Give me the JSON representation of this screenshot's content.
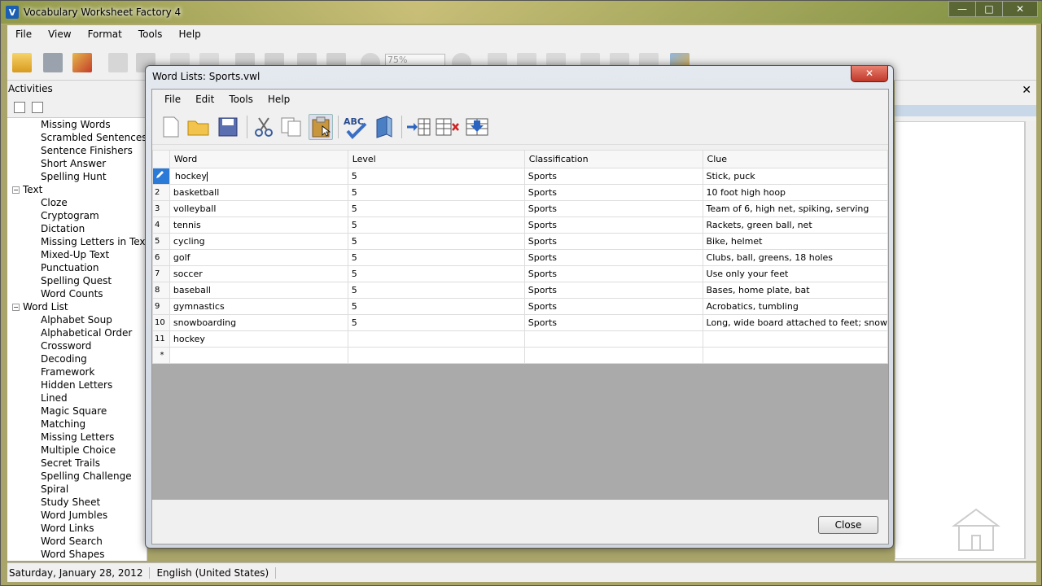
{
  "app": {
    "title": "Vocabulary Worksheet Factory 4",
    "icon_letter": "V"
  },
  "window_buttons": {
    "minimize": "—",
    "maximize": "□",
    "close": "✕"
  },
  "menu": [
    "File",
    "View",
    "Format",
    "Tools",
    "Help"
  ],
  "toolbar": {
    "zoom_value": "75%"
  },
  "activities": {
    "header": "Activities",
    "items": [
      {
        "label": "Missing Words",
        "level": 1
      },
      {
        "label": "Scrambled Sentences",
        "level": 1
      },
      {
        "label": "Sentence Finishers",
        "level": 1
      },
      {
        "label": "Short Answer",
        "level": 1
      },
      {
        "label": "Spelling Hunt",
        "level": 1
      },
      {
        "label": "Text",
        "level": 0
      },
      {
        "label": "Cloze",
        "level": 1
      },
      {
        "label": "Cryptogram",
        "level": 1
      },
      {
        "label": "Dictation",
        "level": 1
      },
      {
        "label": "Missing Letters in Text",
        "level": 1
      },
      {
        "label": "Mixed-Up Text",
        "level": 1
      },
      {
        "label": "Punctuation",
        "level": 1
      },
      {
        "label": "Spelling Quest",
        "level": 1
      },
      {
        "label": "Word Counts",
        "level": 1
      },
      {
        "label": "Word List",
        "level": 0
      },
      {
        "label": "Alphabet Soup",
        "level": 1
      },
      {
        "label": "Alphabetical Order",
        "level": 1
      },
      {
        "label": "Crossword",
        "level": 1
      },
      {
        "label": "Decoding",
        "level": 1
      },
      {
        "label": "Framework",
        "level": 1
      },
      {
        "label": "Hidden Letters",
        "level": 1
      },
      {
        "label": "Lined",
        "level": 1
      },
      {
        "label": "Magic Square",
        "level": 1
      },
      {
        "label": "Matching",
        "level": 1
      },
      {
        "label": "Missing Letters",
        "level": 1
      },
      {
        "label": "Multiple Choice",
        "level": 1
      },
      {
        "label": "Secret Trails",
        "level": 1
      },
      {
        "label": "Spelling Challenge",
        "level": 1
      },
      {
        "label": "Spiral",
        "level": 1
      },
      {
        "label": "Study Sheet",
        "level": 1
      },
      {
        "label": "Word Jumbles",
        "level": 1
      },
      {
        "label": "Word Links",
        "level": 1
      },
      {
        "label": "Word Search",
        "level": 1
      },
      {
        "label": "Word Shapes",
        "level": 1
      }
    ]
  },
  "status": {
    "date": "Saturday, January 28, 2012",
    "language": "English (United States)"
  },
  "dialog": {
    "title": "Word Lists:  Sports.vwl",
    "close_x": "✕",
    "menu": [
      "File",
      "Edit",
      "Tools",
      "Help"
    ],
    "spellcheck_label": "ABC",
    "columns": [
      "Word",
      "Level",
      "Classification",
      "Clue"
    ],
    "rows": [
      {
        "num": "",
        "word": "hockey",
        "level": "5",
        "classification": "Sports",
        "clue": "Stick, puck"
      },
      {
        "num": "2",
        "word": "basketball",
        "level": "5",
        "classification": "Sports",
        "clue": "10 foot high hoop"
      },
      {
        "num": "3",
        "word": "volleyball",
        "level": "5",
        "classification": "Sports",
        "clue": "Team of 6, high net, spiking, serving"
      },
      {
        "num": "4",
        "word": "tennis",
        "level": "5",
        "classification": "Sports",
        "clue": "Rackets, green ball, net"
      },
      {
        "num": "5",
        "word": "cycling",
        "level": "5",
        "classification": "Sports",
        "clue": "Bike, helmet"
      },
      {
        "num": "6",
        "word": "golf",
        "level": "5",
        "classification": "Sports",
        "clue": "Clubs, ball, greens, 18 holes"
      },
      {
        "num": "7",
        "word": "soccer",
        "level": "5",
        "classification": "Sports",
        "clue": "Use only your feet"
      },
      {
        "num": "8",
        "word": "baseball",
        "level": "5",
        "classification": "Sports",
        "clue": "Bases, home plate, bat"
      },
      {
        "num": "9",
        "word": "gymnastics",
        "level": "5",
        "classification": "Sports",
        "clue": "Acrobatics, tumbling"
      },
      {
        "num": "10",
        "word": "snowboarding",
        "level": "5",
        "classification": "Sports",
        "clue": "Long, wide board attached to feet; snow"
      },
      {
        "num": "11",
        "word": "hockey",
        "level": "",
        "classification": "",
        "clue": ""
      }
    ],
    "new_row_marker": "*",
    "close_button": "Close"
  }
}
